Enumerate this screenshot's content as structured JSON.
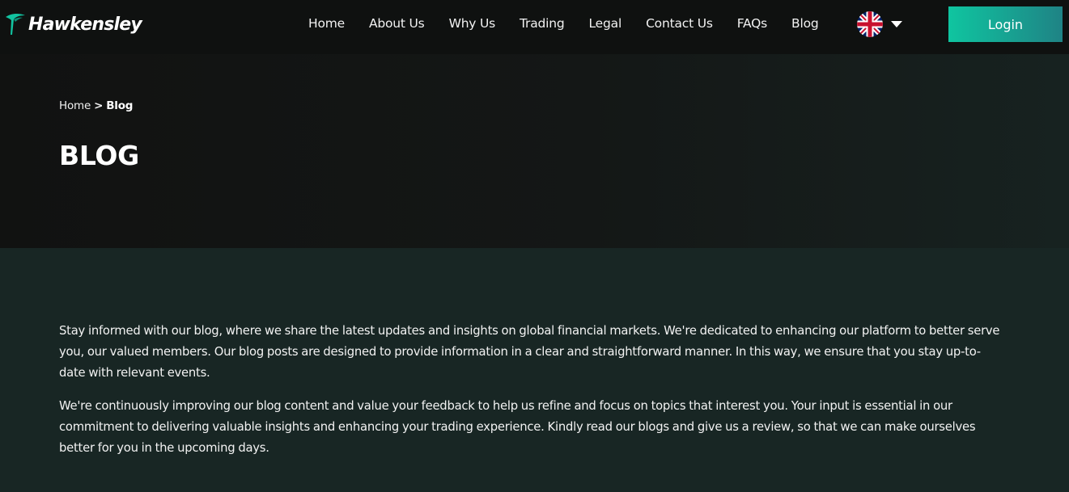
{
  "header": {
    "brand": "Hawkensley",
    "nav": [
      {
        "label": "Home"
      },
      {
        "label": "About Us"
      },
      {
        "label": "Why Us"
      },
      {
        "label": "Trading"
      },
      {
        "label": "Legal"
      },
      {
        "label": "Contact Us"
      },
      {
        "label": "FAQs"
      },
      {
        "label": "Blog"
      }
    ],
    "language_icon": "uk-flag-icon",
    "dropdown_icon": "caret-down-icon",
    "login_label": "Login"
  },
  "hero": {
    "breadcrumb": {
      "home": "Home",
      "separator": ">",
      "current": "Blog"
    },
    "title": "BLOG"
  },
  "content": {
    "paragraphs": [
      "Stay informed with our blog, where we share the latest updates and insights on global financial markets. We're dedicated to enhancing our platform to better serve you, our valued members. Our blog posts are designed to provide information in a clear and straightforward manner. In this way, we ensure that you stay up-to-date with relevant events.",
      "We're continuously improving our blog content and value your feedback to help us refine and focus on topics that interest you. Your input is essential in our commitment to delivering valuable insights and enhancing your trading experience. Kindly read our blogs and give us a review, so that we can make ourselves better for you in the upcoming days."
    ]
  },
  "colors": {
    "accent_start": "#0fc5a0",
    "accent_end": "#1f8385",
    "nav_background": "#0f1110",
    "page_background": "#182624"
  }
}
